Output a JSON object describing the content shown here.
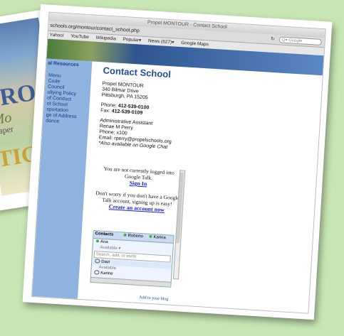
{
  "window": {
    "title": "Propel MONTOUR - Contact School",
    "url": "schools.org/montour/contact_school.php",
    "search_placeholder": "Google"
  },
  "bookmarks": [
    "Yahoo!",
    "YouTube",
    "Wikipedia",
    "Popular▾",
    "News (627)▾",
    "Google Maps"
  ],
  "background_photo": {
    "line1": "PRO",
    "line2": "Mo",
    "line3": "paper",
    "line4": "TIG"
  },
  "sidebar": {
    "header": "al Resources",
    "items": [
      "Menu",
      "Code",
      "Council",
      "ullying Policy",
      "of Conduct",
      "ot School",
      "sportation",
      "ge of Address",
      "dance"
    ]
  },
  "content": {
    "title": "Contact School",
    "school_name": "Propel MONTOUR",
    "street": "340 Bilmar Drive",
    "city": "Pittsburgh, PA 15205",
    "phone_label": "Phone:",
    "phone": "412-539-0100",
    "fax_label": "Fax:",
    "fax": "412-539-0109",
    "role": "Administrative Assistant",
    "person": "Renae M Perry",
    "ext": "Phone: x100",
    "email": "Email: rperry@propelschools.org",
    "note": "*Also available on Google Chat"
  },
  "gtalk": {
    "not_logged": "You are not currently logged into Google Talk.",
    "sign_in": "Sign In",
    "worry": "Don't worry if you don't have a Google Talk account, signing up is easy!",
    "create": "Create an account now"
  },
  "contacts": {
    "tab_label": "Contacts",
    "tab2": "Roberto",
    "tab3": "Karina",
    "me_name": "Ana",
    "me_status": "Available",
    "search_placeholder": "Search, add, or invite",
    "rows": [
      {
        "name": "Davi",
        "status": "Available"
      },
      {
        "name": "Karine",
        "status": ""
      }
    ]
  },
  "footer": "Add to your blog",
  "colors": {
    "accent": "#1f4a9e",
    "sidebar": "#8fb3df",
    "background": "#c8e6b4"
  }
}
